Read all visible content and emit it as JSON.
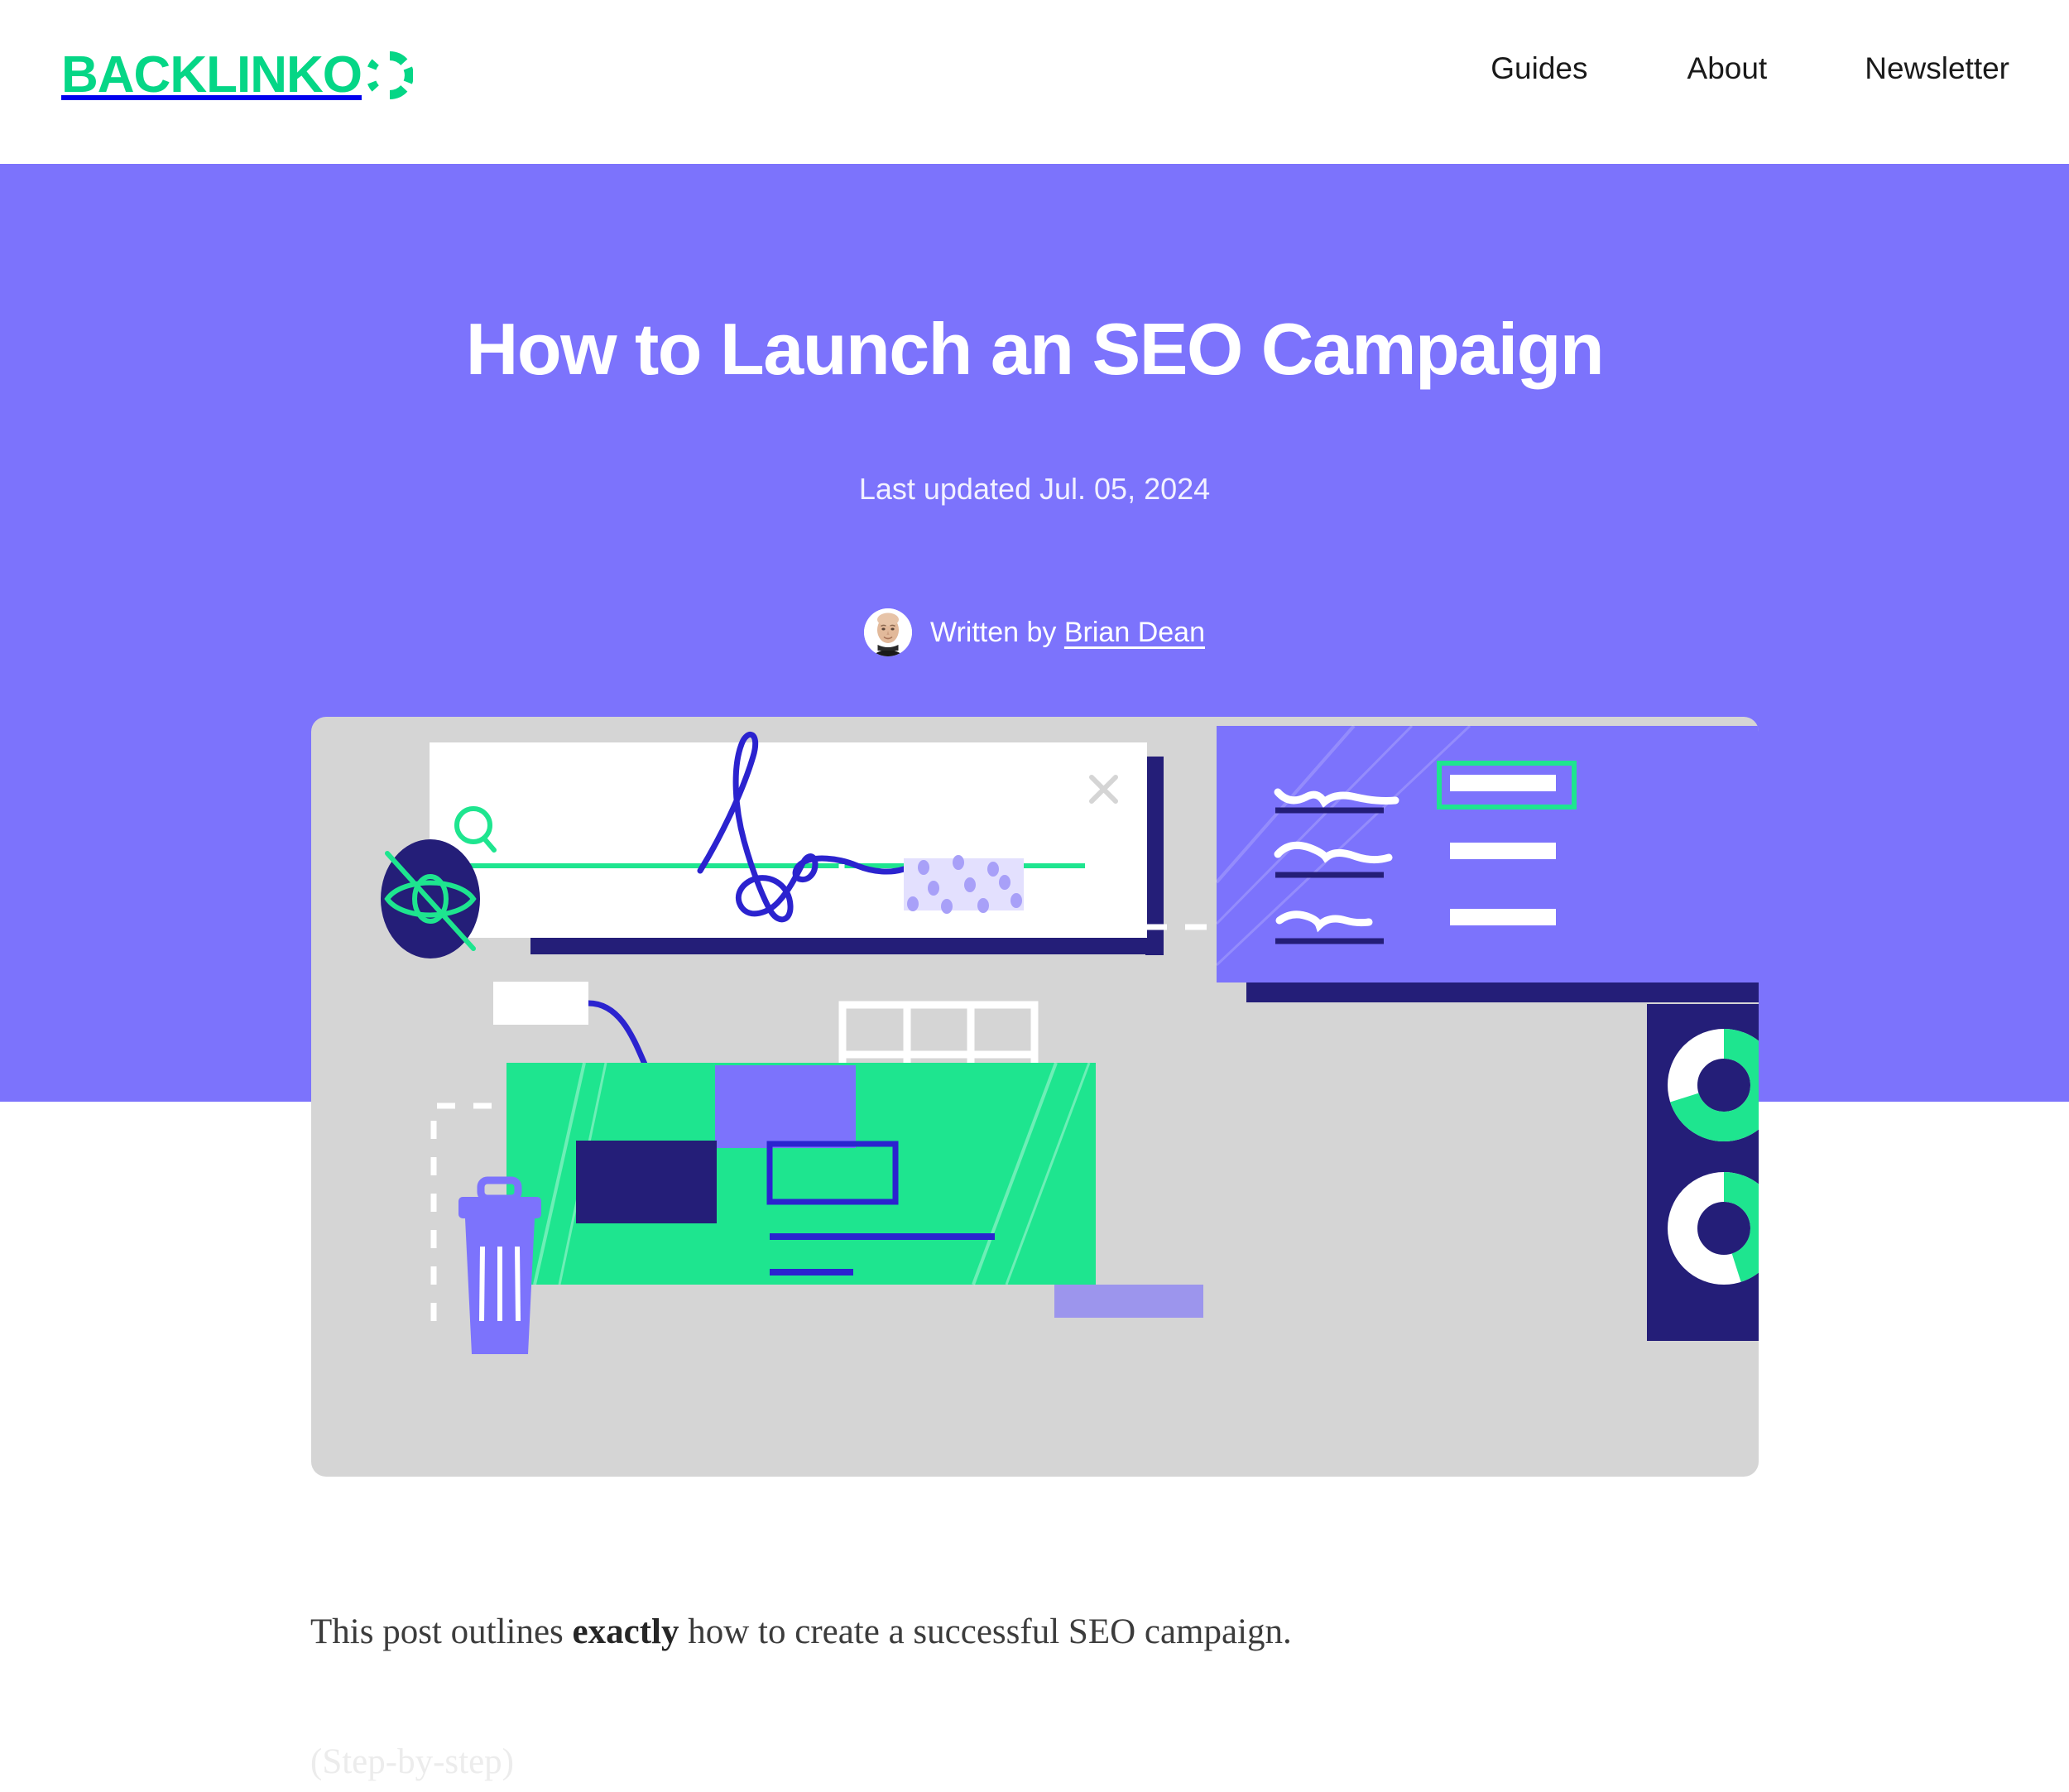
{
  "header": {
    "logo_text": "BACKLINKO",
    "logo_accent_color": "#05D686",
    "nav": [
      {
        "label": "Guides"
      },
      {
        "label": "About"
      },
      {
        "label": "Newsletter"
      }
    ]
  },
  "hero": {
    "background_color": "#7C73FC",
    "title": "How to Launch an SEO Campaign",
    "date_label": "Last updated Jul. 05, 2024",
    "byline_prefix": "Written by",
    "author_name": "Brian Dean",
    "avatar_alt": "Brian Dean portrait"
  },
  "illustration": {
    "background_color": "#D5D5D5",
    "accent_green": "#1EE58F",
    "accent_purple": "#7C73FC",
    "accent_navy": "#241E78",
    "accent_blue": "#2B23CF",
    "search_card_close": "×",
    "search_icon": "magnifier",
    "donut_one_percent": 70,
    "donut_two_percent": 45
  },
  "article": {
    "paragraph_1_before": "This post outlines ",
    "paragraph_1_bold": "exactly",
    "paragraph_1_after": " how to create a successful SEO campaign.",
    "paragraph_2": "(Step-by-step)"
  }
}
